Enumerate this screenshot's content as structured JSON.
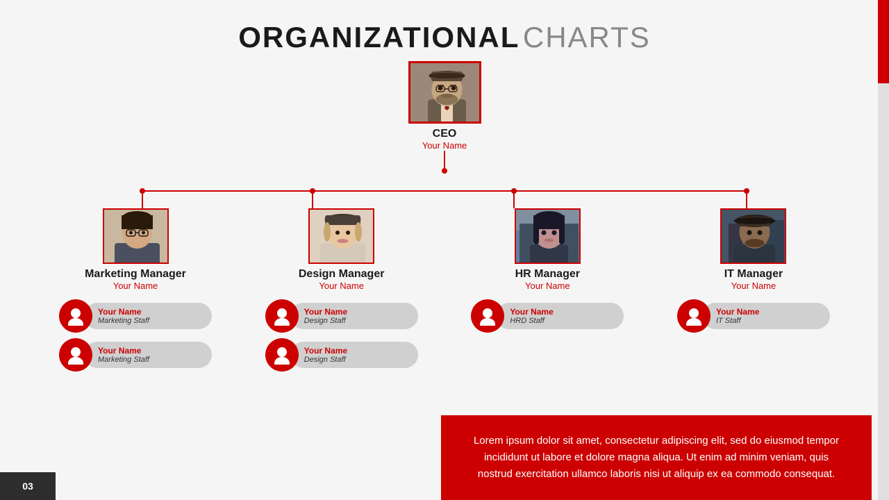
{
  "title": {
    "bold": "ORGANIZATIONAL",
    "light": "CHARTS"
  },
  "page_number": "03",
  "ceo": {
    "role": "CEO",
    "name": "Your Name"
  },
  "managers": [
    {
      "role": "Marketing Manager",
      "name": "Your Name",
      "photo_class": "photo-marketing",
      "staff": [
        {
          "name": "Your Name",
          "role": "Marketing Staff"
        },
        {
          "name": "Your Name",
          "role": "Marketing Staff"
        }
      ]
    },
    {
      "role": "Design Manager",
      "name": "Your Name",
      "photo_class": "photo-design",
      "staff": [
        {
          "name": "Your Name",
          "role": "Design Staff"
        },
        {
          "name": "Your Name",
          "role": "Design Staff"
        }
      ]
    },
    {
      "role": "HR Manager",
      "name": "Your Name",
      "photo_class": "photo-hr",
      "staff": [
        {
          "name": "Your Name",
          "role": "HRD Staff"
        }
      ]
    },
    {
      "role": "IT Manager",
      "name": "Your Name",
      "photo_class": "photo-it",
      "staff": [
        {
          "name": "Your Name",
          "role": "IT Staff"
        }
      ]
    }
  ],
  "lorem_text": "Lorem ipsum dolor sit amet, consectetur adipiscing elit, sed do eiusmod tempor incididunt ut labore et dolore magna aliqua. Ut enim ad minim veniam, quis nostrud exercitation ullamco laboris nisi ut aliquip ex ea commodo consequat.",
  "scrollbar": {
    "color": "#c00"
  }
}
